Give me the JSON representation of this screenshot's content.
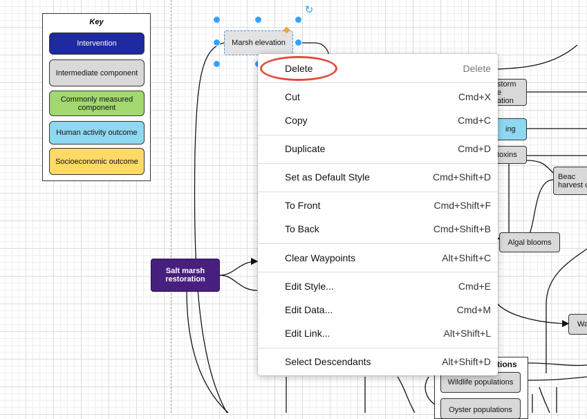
{
  "legend": {
    "title": "Key",
    "items": [
      {
        "label": "Intervention",
        "color": "#1d2aa1",
        "text_color": "#ffffff"
      },
      {
        "label": "Intermediate component",
        "color": "#d9d9d9",
        "text_color": "#111111"
      },
      {
        "label": "Commonly measured component",
        "color": "#a3d86f",
        "text_color": "#111111"
      },
      {
        "label": "Human activity outcome",
        "color": "#8fd8f2",
        "text_color": "#111111"
      },
      {
        "label": "Socioeconomic outcome",
        "color": "#ffd966",
        "text_color": "#111111"
      }
    ]
  },
  "diagram": {
    "selected_node": "Marsh elevation",
    "nodes": {
      "salt_marsh": "Salt marsh restoration",
      "storm": "storm\ne\nation",
      "ing": "ing",
      "toxins": "toxins",
      "beach": "Beac\nharvest c",
      "algal": "Algal blooms",
      "wa": "Wa",
      "group_title": "tions",
      "wildlife": "Wildlife populations",
      "oyster": "Oyster populations"
    }
  },
  "context_menu": {
    "highlighted_item": "Delete",
    "highlight_color": "#e14d3c",
    "items": [
      {
        "label": "Delete",
        "shortcut": "Delete"
      },
      {
        "label": "Cut",
        "shortcut": "Cmd+X"
      },
      {
        "label": "Copy",
        "shortcut": "Cmd+C"
      },
      {
        "label": "Duplicate",
        "shortcut": "Cmd+D"
      },
      {
        "label": "Set as Default Style",
        "shortcut": "Cmd+Shift+D"
      },
      {
        "label": "To Front",
        "shortcut": "Cmd+Shift+F"
      },
      {
        "label": "To Back",
        "shortcut": "Cmd+Shift+B"
      },
      {
        "label": "Clear Waypoints",
        "shortcut": "Alt+Shift+C"
      },
      {
        "label": "Edit Style...",
        "shortcut": "Cmd+E"
      },
      {
        "label": "Edit Data...",
        "shortcut": "Cmd+M"
      },
      {
        "label": "Edit Link...",
        "shortcut": "Alt+Shift+L"
      },
      {
        "label": "Select Descendants",
        "shortcut": "Alt+Shift+D"
      }
    ]
  }
}
